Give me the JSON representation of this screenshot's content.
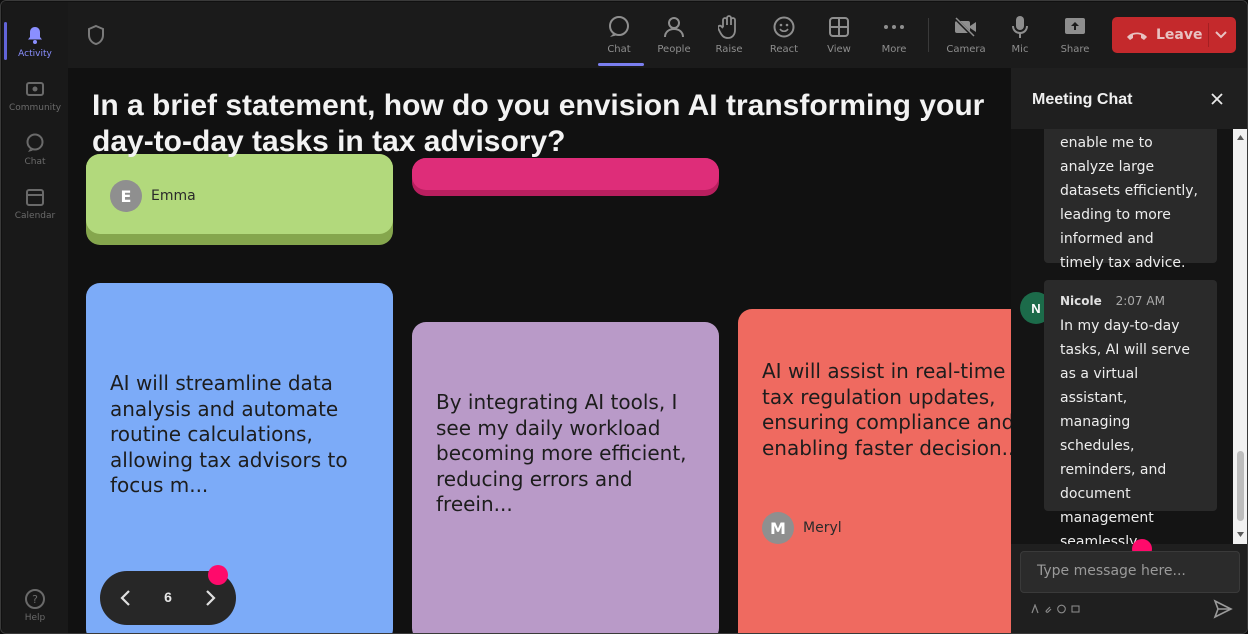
{
  "rail": {
    "items": [
      {
        "label": "Activity",
        "icon": "bell-icon",
        "active": true
      },
      {
        "label": "Community",
        "icon": "community-icon",
        "active": false
      },
      {
        "label": "Chat",
        "icon": "chat-icon",
        "active": false
      },
      {
        "label": "Calendar",
        "icon": "calendar-icon",
        "active": false
      },
      {
        "label": "Help",
        "icon": "help-icon",
        "active": false
      }
    ]
  },
  "toolbar": {
    "buttons": [
      {
        "label": "Chat",
        "icon": "chat-icon",
        "active": true
      },
      {
        "label": "People",
        "icon": "people-icon"
      },
      {
        "label": "Raise",
        "icon": "raise-hand-icon"
      },
      {
        "label": "React",
        "icon": "react-smiley-icon"
      },
      {
        "label": "View",
        "icon": "view-grid-icon"
      },
      {
        "label": "More",
        "icon": "more-dots-icon"
      },
      {
        "label": "Camera",
        "icon": "camera-off-icon"
      },
      {
        "label": "Mic",
        "icon": "mic-icon"
      },
      {
        "label": "Share",
        "icon": "share-icon"
      }
    ],
    "leave_label": "Leave",
    "leave_color": "#c4292c"
  },
  "stage": {
    "question": "In a brief statement, how do you envision AI transforming your day-to-day tasks in tax advisory?",
    "cards": [
      {
        "author_initial": "E",
        "author": "Emma",
        "color": "#b2d97c",
        "text": ""
      },
      {
        "author_initial": "",
        "author": "",
        "color": "#de2d79",
        "text": ""
      },
      {
        "text": "AI will streamline data analysis and automate routine calculations, allowing tax advisors to focus m...",
        "color": "#7cabf8",
        "author_initial": "",
        "author": ""
      },
      {
        "text": "By integrating AI tools, I see my daily workload becoming more efficient, reducing errors and freein...",
        "color": "#b99ac8",
        "author_initial": "",
        "author": ""
      },
      {
        "text": "AI will assist in real-time tax regulation updates, ensuring compliance and enabling faster decision...",
        "color": "#ef6a60",
        "author_initial": "M",
        "author": "Meryl"
      }
    ],
    "page_number": "6"
  },
  "chat": {
    "title": "Meeting Chat",
    "messages": [
      {
        "sender": "",
        "time": "",
        "text": "enable me to analyze large datasets efficiently, leading to more informed and timely tax advice."
      },
      {
        "sender": "Nicole",
        "initial": "N",
        "time": "2:07 AM",
        "text": "In my day-to-day tasks, AI will serve as a virtual assistant, managing schedules, reminders, and document management seamlessly."
      }
    ],
    "input_placeholder": "Type message here...",
    "accent": "#ff0a6b"
  }
}
